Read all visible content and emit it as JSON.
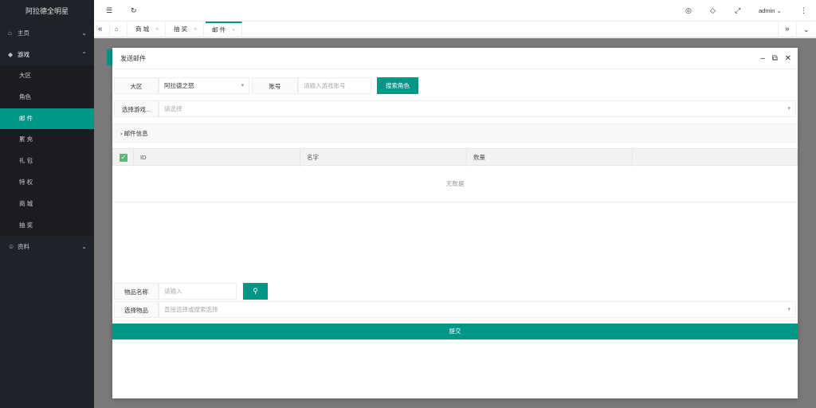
{
  "app": {
    "title": "阿拉德全明星"
  },
  "sidebar": {
    "items": [
      {
        "label": "主页",
        "icon": "home-icon"
      },
      {
        "label": "游戏",
        "icon": "diamond-icon"
      },
      {
        "label": "资料",
        "icon": "user-icon"
      }
    ],
    "game_sub": [
      "大区",
      "角色",
      "邮 件",
      "累 充",
      "礼 包",
      "特 权",
      "商 城",
      "抽 奖"
    ]
  },
  "header": {
    "user": "admin"
  },
  "tabs": [
    {
      "label": "商 城"
    },
    {
      "label": "抽 奖"
    },
    {
      "label": "邮 件"
    }
  ],
  "modal": {
    "title": "发送邮件",
    "region_label": "大区",
    "region_value": "阿拉德之怒",
    "account_label": "账号",
    "account_placeholder": "请输入游戏账号",
    "search_role_label": "搜索角色",
    "select_game_label": "选择游戏...",
    "select_game_placeholder": "请选择",
    "mail_info_label": "邮件信息",
    "table": {
      "columns": [
        "ID",
        "名字",
        "数量"
      ],
      "empty_text": "无数据"
    },
    "item_name_label": "物品名称",
    "item_name_placeholder": "请输入",
    "select_item_label": "选择物品",
    "select_item_placeholder": "直接选择或搜索选择",
    "submit_label": "提交"
  },
  "colors": {
    "accent": "#009688",
    "sidebar_bg": "#20222a",
    "checkbox": "#5FB878"
  }
}
